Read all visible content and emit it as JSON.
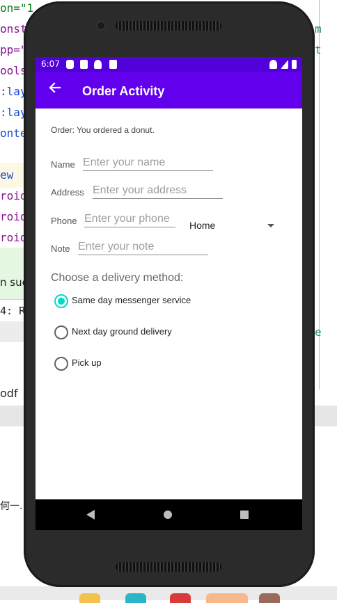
{
  "background_ide": {
    "code_lines": [
      "on=\"1",
      "onst",
      "pp=\"",
      "ools",
      ":lay",
      ":lay",
      "onte",
      "",
      "ew",
      "roid",
      "roid",
      "roid"
    ],
    "tooltip_text": "n suc",
    "run_text": "4: Ru",
    "pdf_text": "odf",
    "cn_text": "何一...",
    "right_chars": [
      "m",
      "t",
      "e"
    ]
  },
  "status_bar": {
    "time": "6:07",
    "color": "#5101d9"
  },
  "app_bar": {
    "title": "Order Activity",
    "back_icon": "arrow-left-icon",
    "color": "#6200ee"
  },
  "order": {
    "message": "Order: You ordered a donut."
  },
  "form": {
    "name": {
      "label": "Name",
      "placeholder": "Enter your name"
    },
    "address": {
      "label": "Address",
      "placeholder": "Enter your address"
    },
    "phone": {
      "label": "Phone",
      "placeholder": "Enter your phone",
      "type_selected": "Home"
    },
    "note": {
      "label": "Note",
      "placeholder": "Enter your note"
    }
  },
  "delivery": {
    "title": "Choose a delivery method:",
    "options": [
      {
        "label": "Same day messenger service",
        "checked": true
      },
      {
        "label": "Next day ground delivery",
        "checked": false
      },
      {
        "label": "Pick up",
        "checked": false
      }
    ],
    "accent_color": "#03dac5"
  }
}
